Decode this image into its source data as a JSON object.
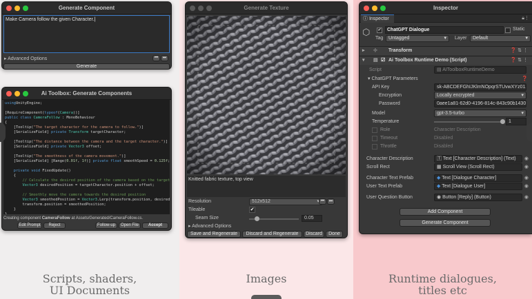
{
  "captions": {
    "left": "Scripts, shaders,\nUI Documents",
    "middle": "Images",
    "right": "Runtime dialogues,\ntitles etc"
  },
  "gen_component": {
    "title": "Generate Component",
    "prompt": "Make Camera follow the given Character.",
    "advanced": "Advanced Options",
    "button": "Generate"
  },
  "ai_components": {
    "title": "Ai Toolbox: Generate Components",
    "status_prefix": "Creating component ",
    "status_name": "CameraFollow",
    "status_suffix": " at Assets/Generated/CameraFollow.cs.",
    "buttons": [
      "Edit Prompt",
      "Reject",
      "Follow-up",
      "Open File",
      "Accept"
    ],
    "code": [
      [
        [
          "kw",
          "using"
        ],
        [
          "",
          "UnityEngine;"
        ]
      ],
      [
        [
          "",
          ""
        ]
      ],
      [
        [
          "",
          "[RequireComponent("
        ],
        [
          "kw",
          "typeof"
        ],
        [
          "",
          "("
        ],
        [
          "ty",
          "Camera"
        ],
        [
          "",
          "))]"
        ]
      ],
      [
        [
          "kw",
          "public class "
        ],
        [
          "ty",
          "CameraFollow"
        ],
        [
          "",
          " : MonoBehaviour"
        ]
      ],
      [
        [
          "",
          "{"
        ]
      ],
      [
        [
          "",
          "    [Tooltip("
        ],
        [
          "st",
          "\"The target character for the camera to follow.\""
        ],
        [
          "",
          ")]"
        ]
      ],
      [
        [
          "",
          "    [SerializeField] "
        ],
        [
          "kw",
          "private "
        ],
        [
          "ty",
          "Transform"
        ],
        [
          "",
          " targetCharacter;"
        ]
      ],
      [
        [
          "",
          ""
        ]
      ],
      [
        [
          "",
          "    [Tooltip("
        ],
        [
          "st",
          "\"The distance between the camera and the target character.\""
        ],
        [
          "",
          ")]"
        ]
      ],
      [
        [
          "",
          "    [SerializeField] "
        ],
        [
          "kw",
          "private "
        ],
        [
          "ty",
          "Vector3"
        ],
        [
          "",
          " offset;"
        ]
      ],
      [
        [
          "",
          ""
        ]
      ],
      [
        [
          "",
          "    [Tooltip("
        ],
        [
          "st",
          "\"The smoothness of the camera movement.\""
        ],
        [
          "",
          ")]"
        ]
      ],
      [
        [
          "",
          "    [SerializeField] [Range("
        ],
        [
          "nu",
          "0.01f"
        ],
        [
          "",
          ", "
        ],
        [
          "nu",
          "1f"
        ],
        [
          "",
          ")] "
        ],
        [
          "kw",
          "private float"
        ],
        [
          "",
          " smoothSpeed = "
        ],
        [
          "nu",
          "0.125f"
        ],
        [
          "",
          ";"
        ]
      ],
      [
        [
          "",
          ""
        ]
      ],
      [
        [
          "",
          "    "
        ],
        [
          "kw",
          "private void"
        ],
        [
          "",
          " FixedUpdate()"
        ]
      ],
      [
        [
          "",
          "    {"
        ]
      ],
      [
        [
          "",
          "        "
        ],
        [
          "cm",
          "// Calculate the desired position of the camera based on the target"
        ]
      ],
      [
        [
          "",
          "        "
        ],
        [
          "ty",
          "Vector3"
        ],
        [
          "",
          " desiredPosition = targetCharacter.position + offset;"
        ]
      ],
      [
        [
          "",
          ""
        ]
      ],
      [
        [
          "",
          "        "
        ],
        [
          "cm",
          "// Smoothly move the camera towards the desired position"
        ]
      ],
      [
        [
          "",
          "        "
        ],
        [
          "ty",
          "Vector3"
        ],
        [
          "",
          " smoothedPosition = "
        ],
        [
          "ty",
          "Vector3"
        ],
        [
          "",
          ".Lerp(transform.position, desiredP"
        ]
      ],
      [
        [
          "",
          "        transform.position = smoothedPosition;"
        ]
      ],
      [
        [
          "",
          "    }"
        ]
      ],
      [
        [
          "",
          "}"
        ]
      ]
    ]
  },
  "texture": {
    "title": "Generate Texture",
    "description": "Knitted fabric texture, top view",
    "resolution_label": "Resolution",
    "resolution_value": "512x512",
    "tileable_label": "Tileable",
    "tileable_check": "✔",
    "seam_label": "Seam Size",
    "seam_value": "0.05",
    "seam_fraction": 0.15,
    "advanced": "Advanced Options",
    "buttons": [
      "Save and Regenerate",
      "Discard and Regenerate",
      "Discard",
      "Done"
    ]
  },
  "inspector": {
    "title": "Inspector",
    "tab": "Inspector",
    "object_name": "ChatGPT Dialogue",
    "static_label": "Static",
    "tag_label": "Tag",
    "tag_value": "Untagged",
    "layer_label": "Layer",
    "layer_value": "Default",
    "transform": "Transform",
    "script_component": "Ai Toolbox Runtime Demo (Script)",
    "script_label": "Script",
    "script_value": "AIToolboxRuntimeDemo",
    "params_header": "ChatGPT Parameters",
    "api_key_label": "API Key",
    "api_key_value": "sk-ABCDEFGhIJKlmNOpqrSTUvwXYz0123",
    "encryption_label": "Encryption",
    "encryption_value": "Locally encrypted",
    "password_label": "Password",
    "password_value": "0aee1a81-62d0-4196-814c-843c90b1430e",
    "model_label": "Model",
    "model_value": "gpt-3.5-turbo",
    "temperature_label": "Temperature",
    "temperature_value": "1",
    "temperature_fraction": 1,
    "role_label": "Role",
    "role_value": "Character Description",
    "timeout_label": "Timeout",
    "timeout_value": "Disabled",
    "throttle_label": "Throttle",
    "throttle_value": "Disabled",
    "refs": [
      {
        "label": "Character Description",
        "value": "Text [Character Description] (Text)"
      },
      {
        "label": "Scroll Rect",
        "value": "Scroll View (Scroll Rect)"
      },
      {
        "label": "Character Text Prefab",
        "value": "Text [Dialogue Character]"
      },
      {
        "label": "User Text Prefab",
        "value": "Text [Dialogue User]"
      },
      {
        "label": "User Question Button",
        "value": "Button [Reply] (Button)"
      }
    ],
    "add_component": "Add Component",
    "generate_component": "Generate Component"
  }
}
